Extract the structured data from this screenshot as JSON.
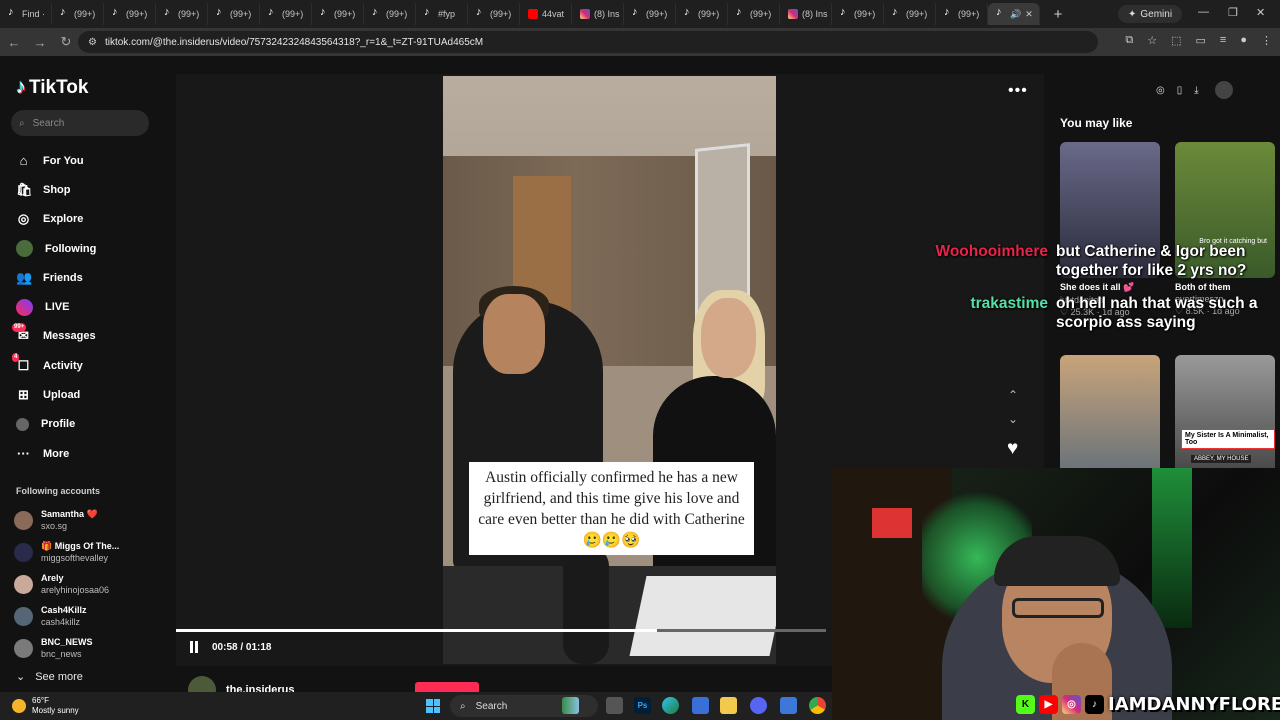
{
  "browser": {
    "tabs": [
      {
        "label": "Find ·",
        "icon": "tiktok-icon"
      },
      {
        "label": "(99+)",
        "icon": "tiktok-icon"
      },
      {
        "label": "(99+)",
        "icon": "tiktok-icon"
      },
      {
        "label": "(99+)",
        "icon": "tiktok-icon"
      },
      {
        "label": "(99+)",
        "icon": "tiktok-icon"
      },
      {
        "label": "(99+)",
        "icon": "tiktok-icon"
      },
      {
        "label": "(99+)",
        "icon": "tiktok-icon"
      },
      {
        "label": "(99+)",
        "icon": "tiktok-icon"
      },
      {
        "label": "#fyp",
        "icon": "tiktok-icon"
      },
      {
        "label": "(99+)",
        "icon": "tiktok-icon"
      },
      {
        "label": "44vat",
        "icon": "youtube-icon"
      },
      {
        "label": "(8) Ins",
        "icon": "instagram-icon"
      },
      {
        "label": "(99+)",
        "icon": "tiktok-icon"
      },
      {
        "label": "(99+)",
        "icon": "tiktok-icon"
      },
      {
        "label": "(99+)",
        "icon": "tiktok-icon"
      },
      {
        "label": "(8) Ins",
        "icon": "instagram-icon"
      },
      {
        "label": "(99+)",
        "icon": "tiktok-icon"
      },
      {
        "label": "(99+)",
        "icon": "tiktok-icon"
      },
      {
        "label": "(99+)",
        "icon": "tiktok-icon"
      }
    ],
    "gemini_label": "Gemini",
    "url": "tiktok.com/@the.insiderus/video/7573242324843564318?_r=1&_t=ZT-91TUAd465cM"
  },
  "tiktok": {
    "logo": "TikTok",
    "search_placeholder": "Search",
    "menu": [
      {
        "label": "For You",
        "icon": "home-icon"
      },
      {
        "label": "Shop",
        "icon": "shop-icon"
      },
      {
        "label": "Explore",
        "icon": "compass-icon"
      },
      {
        "label": "Following",
        "icon": "avatar-icon"
      },
      {
        "label": "Friends",
        "icon": "friends-icon"
      },
      {
        "label": "LIVE",
        "icon": "live-icon"
      },
      {
        "label": "Messages",
        "icon": "messages-icon",
        "badge": "99+"
      },
      {
        "label": "Activity",
        "icon": "activity-icon",
        "badge": "4"
      },
      {
        "label": "Upload",
        "icon": "upload-icon"
      },
      {
        "label": "Profile",
        "icon": "profile-icon"
      },
      {
        "label": "More",
        "icon": "more-icon"
      }
    ],
    "following_title": "Following accounts",
    "following": [
      {
        "name": "Samantha ❤️",
        "handle": "sxo.sg",
        "color": "#8a6b5a"
      },
      {
        "name": "🎁 Miggs Of The...",
        "handle": "miggsofthevalley",
        "color": "#2a2a4a"
      },
      {
        "name": "Arely",
        "handle": "arelyhinojosaa06",
        "color": "#c9a99a"
      },
      {
        "name": "Cash4Killz",
        "handle": "cash4killz",
        "color": "#556677"
      },
      {
        "name": "BNC_NEWS",
        "handle": "bnc_news",
        "color": "#7a7a7a"
      }
    ],
    "see_more": "See more",
    "video": {
      "caption": "Austin officially confirmed he has a new girlfriend, and this time give his love and care even better than he did with Catherine 🥲🥲🥹",
      "time": "00:58 / 01:18",
      "progress": 0.74,
      "author": "the.insiderus"
    },
    "you_may_like": "You may like",
    "recommendations": [
      {
        "title": "She does it all 💕",
        "author": "justdanitaa",
        "meta": "♡ 25.3K · 1d ago",
        "colors": [
          "#6a6a8a",
          "#2a2a3a"
        ]
      },
      {
        "title": "Both of them",
        "author": "evertimeszn",
        "meta": "♡ 8.5K · 1d ago",
        "colors": [
          "#6c8a3a",
          "#3a5a2a"
        ],
        "overlay": "Bro got it catching but"
      },
      {
        "title": "",
        "author": "",
        "meta": "",
        "colors": [
          "#c8a47a",
          "#5a6a7a"
        ]
      },
      {
        "title": "",
        "author": "",
        "meta": "",
        "colors": [
          "#9a9a9a",
          "#3a3a3a"
        ],
        "label1": "My Sister Is A Minimalist, Too",
        "label2": "ABBEY, MY HOUSE"
      }
    ]
  },
  "stream_chat": [
    {
      "user": "Woohooimhere",
      "user_color": "#e8244a",
      "message": "but Catherine & Igor been together for like 2 yrs no?"
    },
    {
      "user": "trakastime",
      "user_color": "#54e0a9",
      "message": "oh hell nah that was such a scorpio ass saying"
    }
  ],
  "webcam": {
    "handle": "IAMDANNYFLORES",
    "socials": [
      "kick-icon",
      "youtube-icon",
      "instagram-icon",
      "tiktok-icon"
    ]
  },
  "taskbar": {
    "temp": "66°F",
    "condition": "Mostly sunny",
    "search_label": "Search"
  }
}
